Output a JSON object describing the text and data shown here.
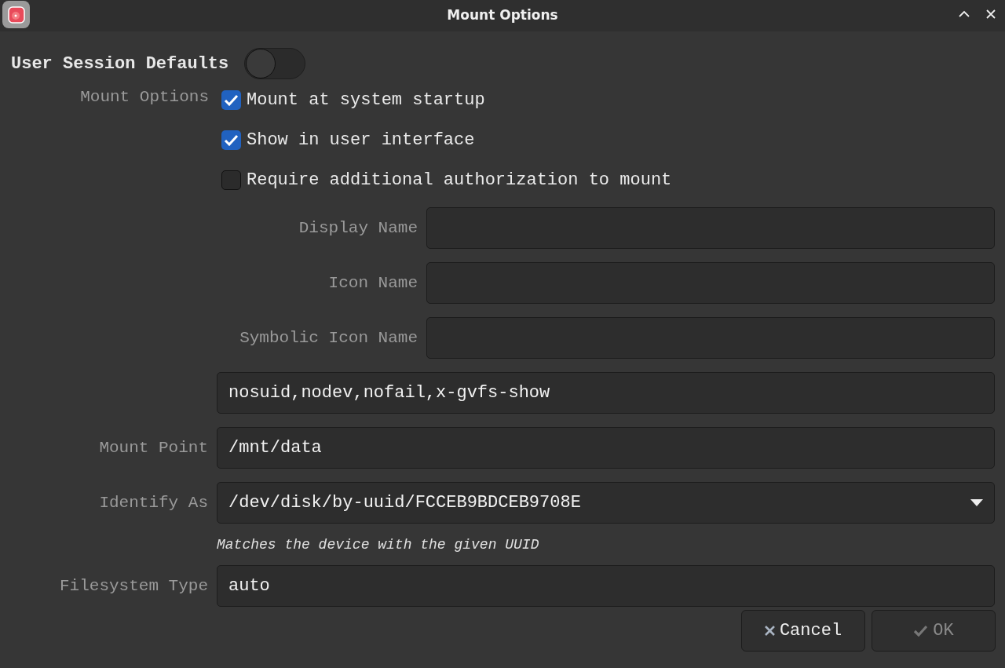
{
  "window": {
    "title": "Mount Options"
  },
  "session_defaults": {
    "label": "User Session Defaults",
    "on": false
  },
  "mount_options": {
    "label": "Mount Options",
    "checkboxes": [
      {
        "label": "Mount at system startup",
        "checked": true
      },
      {
        "label": "Show in user interface",
        "checked": true
      },
      {
        "label": "Require additional authorization to mount",
        "checked": false
      }
    ],
    "fields": [
      {
        "label": "Display Name"
      },
      {
        "label": "Icon Name"
      },
      {
        "label": "Symbolic Icon Name"
      }
    ],
    "options_value": "nosuid,nodev,nofail,x-gvfs-show"
  },
  "mount_point": {
    "label": "Mount Point",
    "value": "/mnt/data"
  },
  "identify_as": {
    "label": "Identify As",
    "value": "/dev/disk/by-uuid/FCCEB9BDCEB9708E",
    "hint": "Matches the device with the given UUID"
  },
  "filesystem_type": {
    "label": "Filesystem Type",
    "value": "auto"
  },
  "buttons": [
    {
      "label": "Cancel",
      "kind": "cancel",
      "disabled": false
    },
    {
      "label": "OK",
      "kind": "ok",
      "disabled": true
    }
  ]
}
